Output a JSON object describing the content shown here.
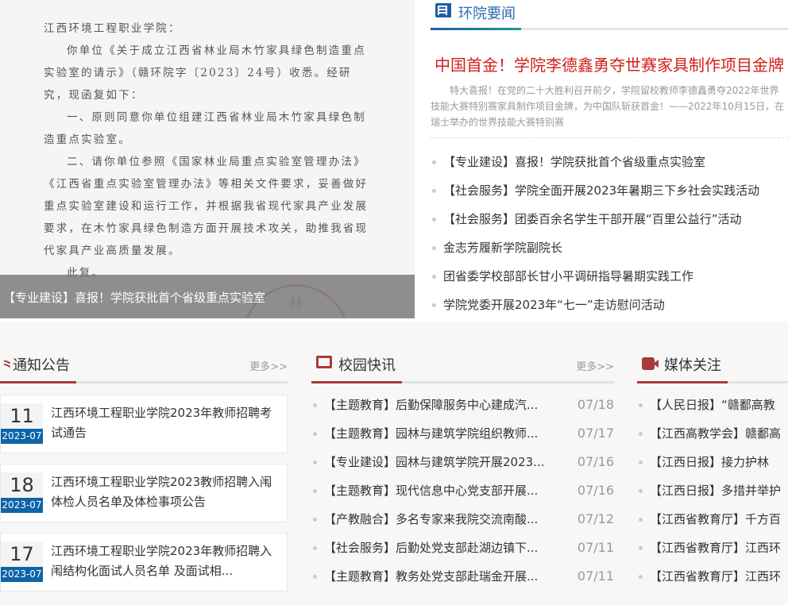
{
  "slider": {
    "image_text": {
      "salutation": "江西环境工程职业学院：",
      "paragraphs": [
        "你单位《关于成立江西省林业局木竹家具绿色制造重点实验室的请示》（赣环院字〔2023〕24号）收悉。经研究，现函复如下：",
        "一、原则同意你单位组建江西省林业局木竹家具绿色制造重点实验室。",
        "二、请你单位参照《国家林业局重点实验室管理办法》《江西省重点实验室管理办法》等相关文件要求，妥善做好重点实验室建设和运行工作，并根据我省现代家具产业发展要求，在木竹家具绿色制造方面开展技术攻关，助推我省现代家具产业高质量发展。",
        "此复。"
      ],
      "stamp": "林"
    },
    "caption": "【专业建设】喜报！学院获批首个省级重点实验室",
    "dots": 5,
    "active_dot": 2
  },
  "news": {
    "title": "环院要闻",
    "headline": "中国首金！学院李德鑫勇夺世赛家具制作项目金牌",
    "summary_line1": "特大喜报！在党的二十大胜利召开前夕，学院留校教师李德鑫勇夺2022年世界技能大赛特别赛家具制",
    "summary_line2": "作项目金牌，为中国队斩获首金！——2022年10月15日，在瑞士举办的世界技能大赛特别赛",
    "items": [
      "【专业建设】喜报！学院获批首个省级重点实验室",
      "【社会服务】学院全面开展2023年暑期三下乡社会实践活动",
      "【社会服务】团委百余名学生干部开展“百里公益行”活动",
      "金志芳履新学院副院长",
      "团省委学校部部长甘小平调研指导暑期实践工作",
      "学院党委开展2023年“七一”走访慰问活动"
    ]
  },
  "notices": {
    "title": "通知公告",
    "more": "更多>>",
    "items": [
      {
        "day": "11",
        "ym": "2023-07",
        "title": "江西环境工程职业学院2023年教师招聘考试通告"
      },
      {
        "day": "18",
        "ym": "2023-07",
        "title": "江西环境工程职业学院2023教师招聘入闱体检人员名单及体检事项公告"
      },
      {
        "day": "17",
        "ym": "2023-07",
        "title": "江西环境工程职业学院2023年教师招聘入闱结构化面试人员名单 及面试相..."
      }
    ]
  },
  "campus": {
    "title": "校园快讯",
    "more": "更多>>",
    "items": [
      {
        "title": "【主题教育】后勤保障服务中心建成汽...",
        "date": "07/18"
      },
      {
        "title": "【主题教育】园林与建筑学院组织教师...",
        "date": "07/17"
      },
      {
        "title": "【专业建设】园林与建筑学院开展2023...",
        "date": "07/16"
      },
      {
        "title": "【主题教育】现代信息中心党支部开展...",
        "date": "07/16"
      },
      {
        "title": "【产教融合】多名专家来我院交流南酸...",
        "date": "07/12"
      },
      {
        "title": "【社会服务】后勤处党支部赴湖边镇下...",
        "date": "07/11"
      },
      {
        "title": "【主题教育】教务处党支部赴瑞金开展...",
        "date": "07/11"
      }
    ]
  },
  "media": {
    "title": "媒体关注",
    "items": [
      "【人民日报】“赣鄱高教",
      "【江西高教学会】赣鄱高",
      "【江西日报】接力护林",
      "【江西日报】多措并举护",
      "【江西省教育厅】千方百",
      "【江西省教育厅】江西环",
      "【江西省教育厅】江西环"
    ]
  },
  "colors": {
    "accent_blue": "#0e64a8",
    "accent_red": "#a83a38",
    "headline_red": "#d0201c"
  }
}
